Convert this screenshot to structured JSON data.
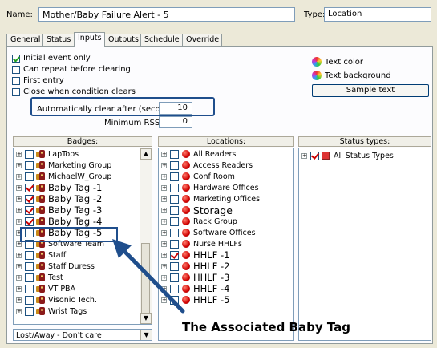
{
  "header": {
    "name_label": "Name:",
    "name_value": "Mother/Baby Failure Alert - 5",
    "type_label": "Type:",
    "type_value": "Location"
  },
  "tabs": [
    {
      "label": "General"
    },
    {
      "label": "Status"
    },
    {
      "label": "Inputs"
    },
    {
      "label": "Outputs"
    },
    {
      "label": "Schedule"
    },
    {
      "label": "Override"
    }
  ],
  "options": {
    "initial_event_only": "Initial event only",
    "can_repeat": "Can repeat before clearing",
    "first_entry": "First entry",
    "close_when_clears": "Close when condition clears",
    "auto_clear_label": "Automatically clear after (seconds):",
    "auto_clear_value": "10",
    "min_rssi_label": "Minimum RSSI:",
    "min_rssi_value": "0"
  },
  "text_style": {
    "text_color": "Text color",
    "text_background": "Text background",
    "sample_text": "Sample text"
  },
  "badges": {
    "header": "Badges:",
    "items": [
      {
        "label": "LapTops",
        "checked": false
      },
      {
        "label": "Marketing Group",
        "checked": false
      },
      {
        "label": "MichaelW_Group",
        "checked": false
      },
      {
        "label": "Baby Tag -1",
        "checked": true
      },
      {
        "label": "Baby Tag -2",
        "checked": true
      },
      {
        "label": "Baby Tag -3",
        "checked": true
      },
      {
        "label": "Baby Tag -4",
        "checked": true
      },
      {
        "label": "Baby Tag -5",
        "checked": false
      },
      {
        "label": "Software Team",
        "checked": false
      },
      {
        "label": "Staff",
        "checked": false
      },
      {
        "label": "Staff Duress",
        "checked": false
      },
      {
        "label": "Test",
        "checked": false
      },
      {
        "label": "VT PBA",
        "checked": false
      },
      {
        "label": "Visonic Tech.",
        "checked": false
      },
      {
        "label": "Wrist Tags",
        "checked": false
      }
    ],
    "filter_value": "Lost/Away - Don't care"
  },
  "locations": {
    "header": "Locations:",
    "items": [
      {
        "label": "All Readers",
        "checked": false
      },
      {
        "label": "Access Readers",
        "checked": false
      },
      {
        "label": "Conf Room",
        "checked": false
      },
      {
        "label": "Hardware Offices",
        "checked": false
      },
      {
        "label": "Marketing Offices",
        "checked": false
      },
      {
        "label": "Storage",
        "checked": false
      },
      {
        "label": "Rack Group",
        "checked": false
      },
      {
        "label": "Software Offices",
        "checked": false
      },
      {
        "label": "Nurse HHLFs",
        "checked": false
      },
      {
        "label": "HHLF -1",
        "checked": true
      },
      {
        "label": "HHLF -2",
        "checked": false
      },
      {
        "label": "HHLF -3",
        "checked": false
      },
      {
        "label": "HHLF -4",
        "checked": false
      },
      {
        "label": "HHLF -5",
        "checked": false
      }
    ]
  },
  "status_types": {
    "header": "Status types:",
    "items": [
      {
        "label": "All Status Types",
        "checked": true
      }
    ]
  },
  "annotation": {
    "caption": "The Associated Baby Tag",
    "color": "#1f4e8c"
  }
}
